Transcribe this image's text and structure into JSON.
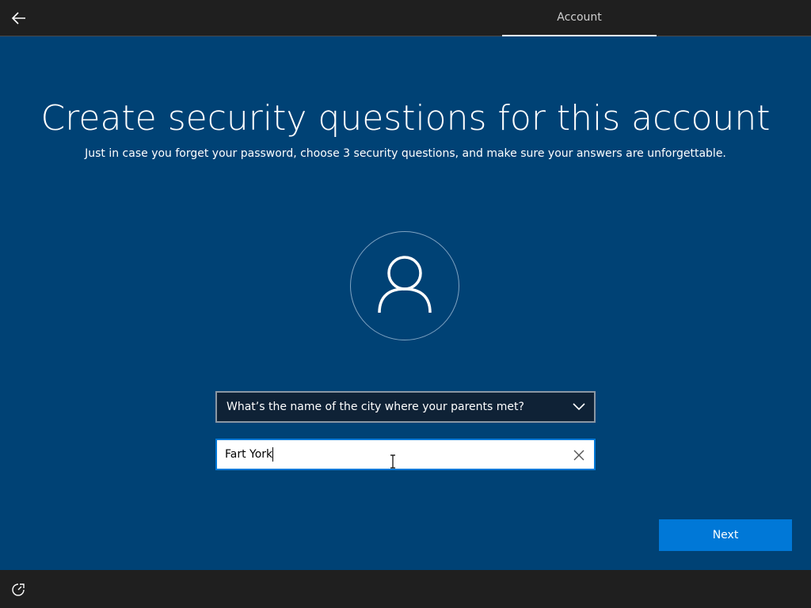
{
  "header": {
    "back_icon": "arrow-left-icon",
    "tab_label": "Account"
  },
  "main": {
    "title": "Create security questions for this account",
    "subtitle": "Just in case you forget your password, choose 3 security questions, and make sure your answers are unforgettable.",
    "avatar_icon": "user-icon",
    "question": {
      "selected": "What’s the name of the city where your parents met?",
      "icon": "chevron-down-icon"
    },
    "answer": {
      "value": "Fart York",
      "clear_icon": "close-icon"
    },
    "next_label": "Next"
  },
  "footer": {
    "ease_icon": "ease-of-access-icon"
  },
  "colors": {
    "background": "#004275",
    "bar": "#1f1f1f",
    "accent": "#0078d7"
  }
}
